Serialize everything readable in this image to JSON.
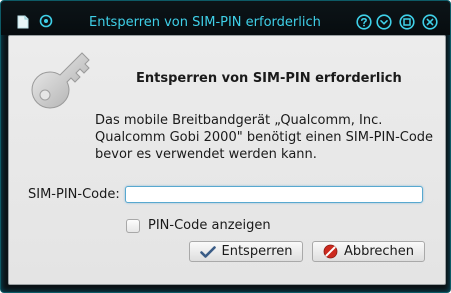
{
  "window": {
    "title": "Entsperren von SIM-PIN erforderlich"
  },
  "dialog": {
    "heading": "Entsperren von SIM-PIN erforderlich",
    "message": "Das mobile Breitbandgerät „Qualcomm, Inc. Qualcomm Gobi 2000\" benötigt einen SIM-PIN-Code bevor es verwendet werden kann.",
    "pin_label": "SIM-PIN-Code:",
    "pin_value": "",
    "show_pin_label": "PIN-Code anzeigen",
    "show_pin_checked": false
  },
  "buttons": {
    "ok_label": "Entsperren",
    "cancel_label": "Abbrechen"
  },
  "icons": {
    "app": "document-icon",
    "pin": "pin-icon",
    "help": "help-icon",
    "minimize": "minimize-icon",
    "maximize": "maximize-icon",
    "close": "close-icon",
    "key": "key-icon",
    "ok": "checkmark-icon",
    "cancel": "cancel-icon"
  },
  "colors": {
    "titlebar_bg": "#070c0f",
    "title_text": "#3fd0e8",
    "dialog_bg": "#e8e8e8",
    "input_focus": "#58a8cf",
    "cancel_icon": "#cc2a1f"
  }
}
